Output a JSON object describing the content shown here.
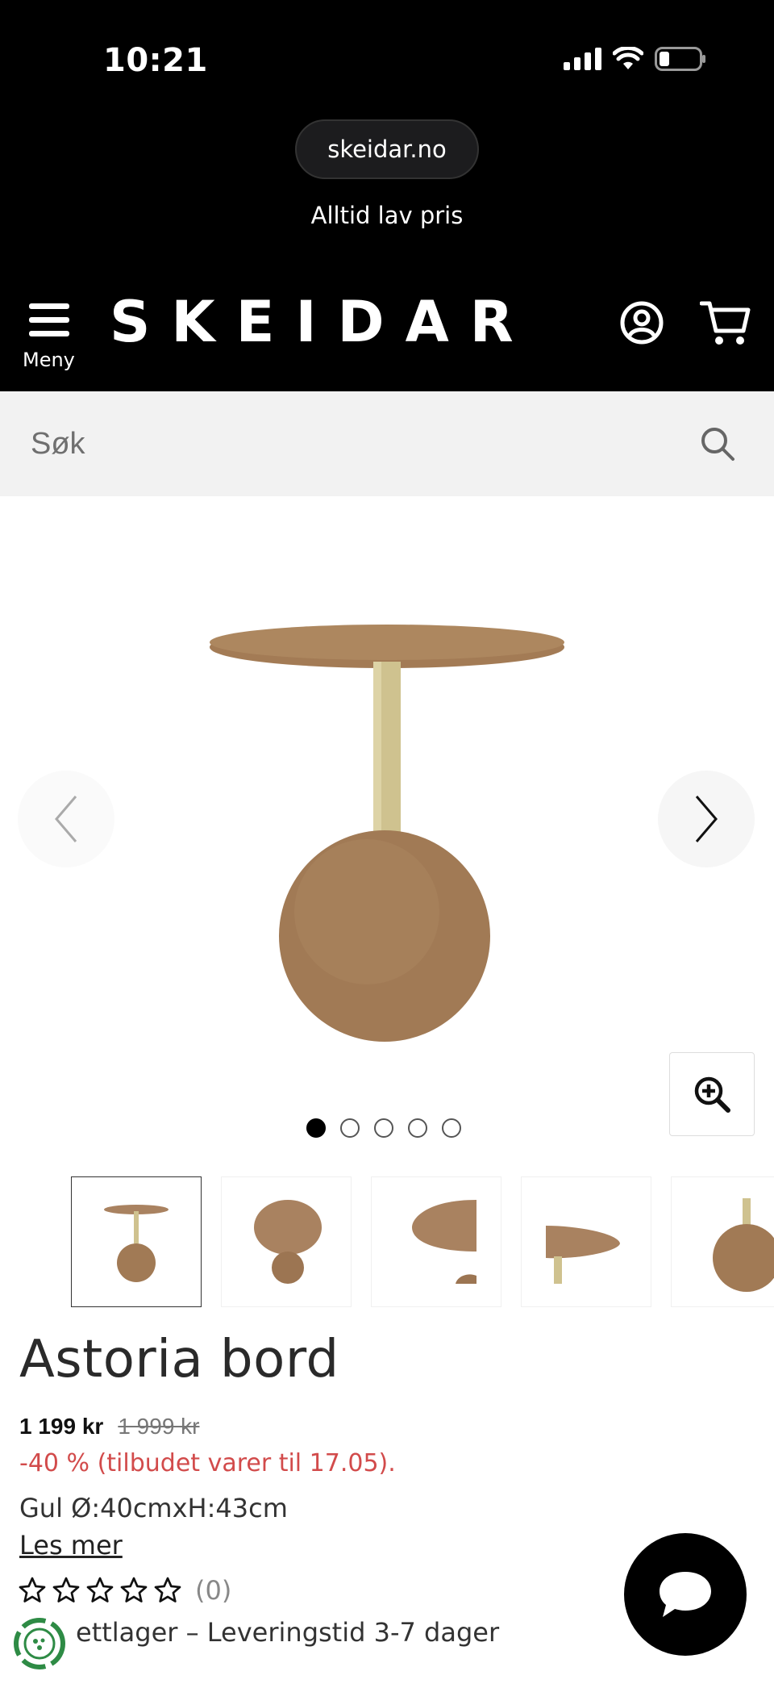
{
  "status_bar": {
    "time": "10:21"
  },
  "browser": {
    "url": "skeidar.no"
  },
  "promo_banner": "Alltid lav pris",
  "header": {
    "menu_label": "Meny",
    "logo": "SKEIDAR"
  },
  "search": {
    "placeholder": "Søk"
  },
  "gallery": {
    "image_count": 5,
    "active_index": 0
  },
  "product": {
    "title": "Astoria bord",
    "price": "1 199 kr",
    "old_price": "1 999 kr",
    "discount": "-40 % (tilbudet varer til 17.05).",
    "variant": "Gul Ø:40cmxH:43cm",
    "read_more": "Les mer",
    "rating": {
      "stars": 0,
      "max": 5,
      "count_label": "(0)"
    },
    "stock": "ettlager – Leveringstid 3-7 dager"
  },
  "colors": {
    "header_bg": "#000000",
    "search_bg": "#f2f2f2",
    "discount_red": "#d24b4b",
    "table_brown": "#a07a55",
    "brass": "#cfc28f"
  },
  "icons": [
    "menu-icon",
    "account-icon",
    "cart-icon",
    "search-icon",
    "chevron-left-icon",
    "chevron-right-icon",
    "zoom-in-icon",
    "star-icon",
    "chat-icon",
    "eco-badge-icon"
  ]
}
